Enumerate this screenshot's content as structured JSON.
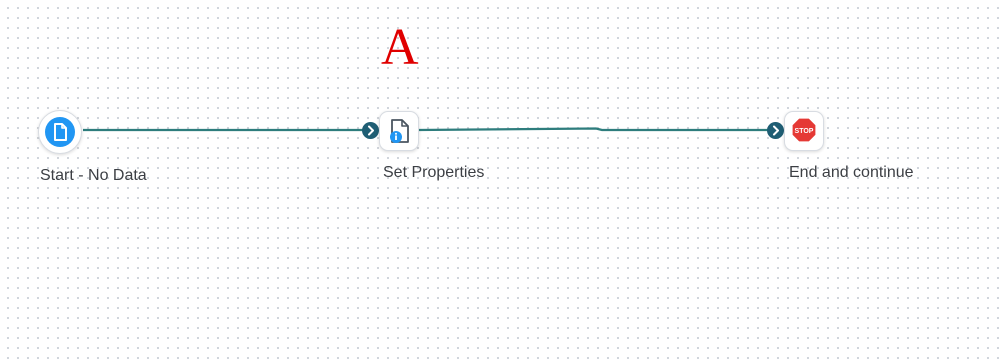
{
  "annotation": {
    "letter": "A",
    "color": "#e00000"
  },
  "workflow": {
    "connector_color": "#2e7d7d",
    "port_color": "#1f5e74",
    "nodes": [
      {
        "id": "start",
        "label": "Start - No Data",
        "icon": "start-file-icon",
        "icon_color": "#2196f3"
      },
      {
        "id": "set_properties",
        "label": "Set Properties",
        "icon": "document-info-icon",
        "icon_color": "#2196f3"
      },
      {
        "id": "end",
        "label": "End and continue",
        "icon": "stop-sign-icon",
        "icon_color": "#e53935",
        "icon_text": "STOP"
      }
    ]
  }
}
